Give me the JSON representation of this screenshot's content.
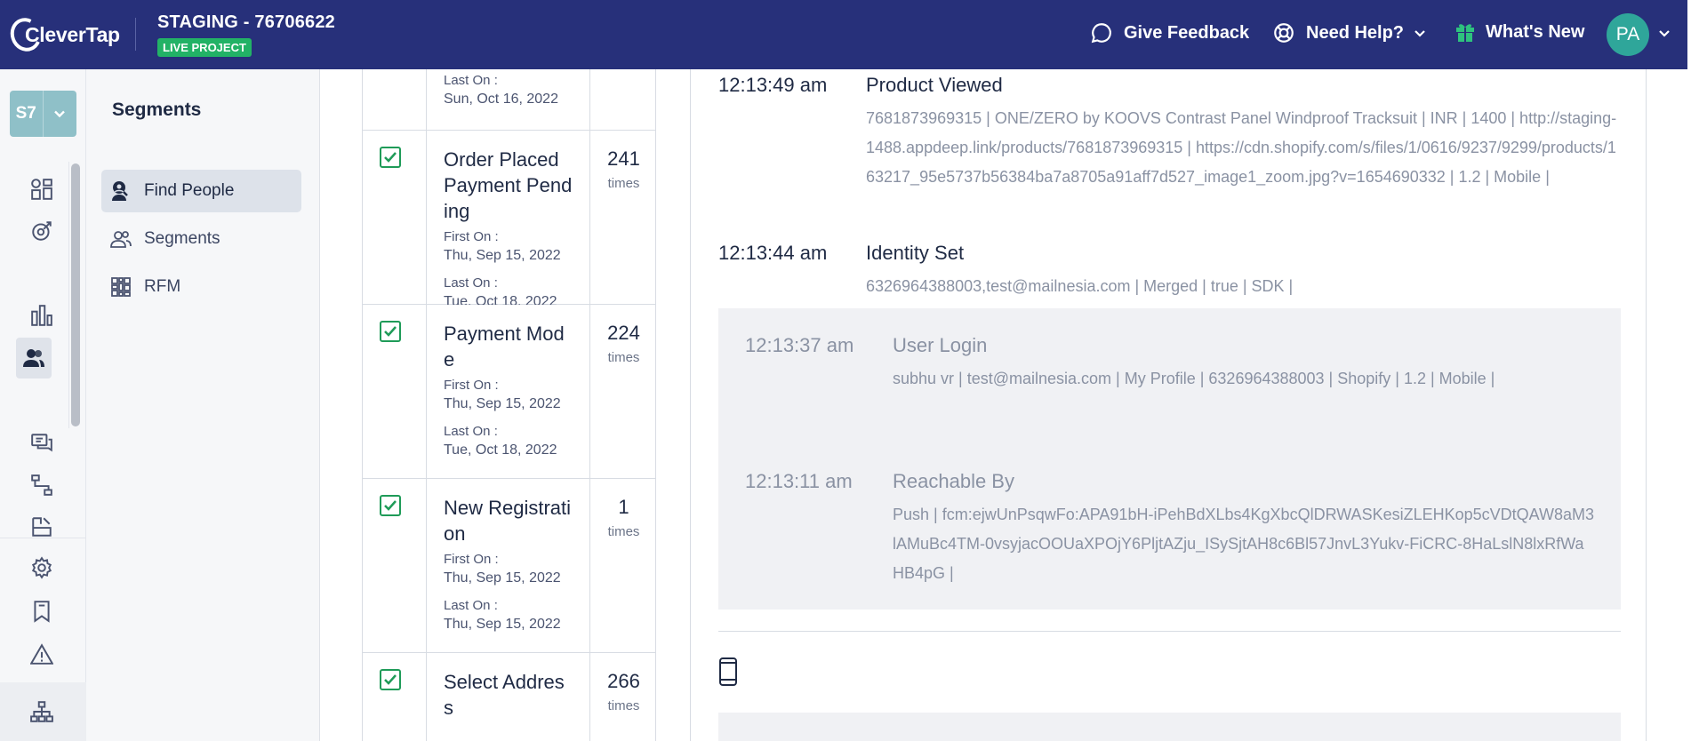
{
  "header": {
    "logo_text": "CleverTap",
    "project_title": "STAGING - 76706622",
    "live_badge": "LIVE PROJECT",
    "give_feedback": "Give Feedback",
    "need_help": "Need Help?",
    "whats_new": "What's New",
    "avatar_initials": "PA"
  },
  "rail": {
    "account_initials": "S7",
    "icons": [
      "dashboard-icon",
      "analytics-icon",
      "bar-chart-icon",
      "people-icon",
      "messages-icon",
      "journeys-icon",
      "campaign-icon",
      "settings-icon",
      "bookmark-icon",
      "warning-icon",
      "sitemap-icon"
    ],
    "active": "people-icon"
  },
  "subnav": {
    "title": "Segments",
    "items": [
      {
        "label": "Find People",
        "icon": "find-people-icon",
        "active": true
      },
      {
        "label": "Segments",
        "icon": "segments-icon",
        "active": false
      },
      {
        "label": "RFM",
        "icon": "rfm-icon",
        "active": false
      }
    ]
  },
  "events": {
    "first_label": "First On :",
    "last_label": "Last On :",
    "times_label": "times",
    "partial_top": {
      "last_on": "Sun, Oct 16, 2022"
    },
    "rows": [
      {
        "name": "Order Placed Payment Pending",
        "count": "241",
        "first_on": "Thu, Sep 15, 2022",
        "last_on": "Tue, Oct 18, 2022",
        "checked": true
      },
      {
        "name": "Payment Mode",
        "count": "224",
        "first_on": "Thu, Sep 15, 2022",
        "last_on": "Tue, Oct 18, 2022",
        "checked": true
      },
      {
        "name": "New Registration",
        "count": "1",
        "first_on": "Thu, Sep 15, 2022",
        "last_on": "Thu, Sep 15, 2022",
        "checked": true
      },
      {
        "name": "Select Address",
        "count": "266",
        "first_on": "",
        "last_on": "",
        "checked": true
      }
    ]
  },
  "timeline": {
    "entries": [
      {
        "time": "12:13:49 am",
        "title": "Product Viewed",
        "props": "7681873969315  |  ONE/ZERO by KOOVS Contrast Panel Windproof Tracksuit  |  INR  |  1400  |  http://staging-1488.appdeep.link/products/7681873969315  |  https://cdn.shopify.com/s/files/1/0616/9237/9299/products/163217_95e5737b56384ba7a8705a91aff7d527_image1_zoom.jpg?v=1654690332  |  1.2  |  Mobile  |"
      },
      {
        "time": "12:13:44 am",
        "title": "Identity Set",
        "props": "6326964388003,test@mailnesia.com  |  Merged  |  true  |  SDK  |"
      }
    ],
    "group_entries": [
      {
        "time": "12:13:37 am",
        "title": "User Login",
        "props": "subhu vr  |  test@mailnesia.com  |  My Profile  |  6326964388003  |  Shopify  |  1.2  |  Mobile  |"
      },
      {
        "time": "12:13:11 am",
        "title": "Reachable By",
        "props": "Push  |  fcm:ejwUnPsqwFo:APA91bH-iPehBdXLbs4KgXbcQlDRWASKesiZLEHKop5cVDtQAW8aM3lAMuBc4TM-0vsyjacOOUaXPOjY6PljtAZju_ISySjtAH8c6Bl57JnvL3Yukv-FiCRC-8HaLslN8lxRfWaHB4pG  |"
      }
    ]
  }
}
